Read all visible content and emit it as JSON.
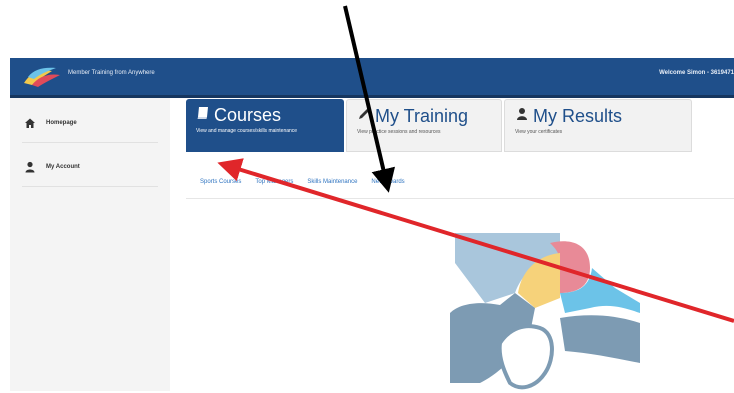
{
  "header": {
    "title": "Member Training from Anywhere",
    "welcome": "Welcome Simon - 3619471"
  },
  "sidebar": {
    "items": [
      {
        "label": "Homepage",
        "icon": "home-icon"
      },
      {
        "label": "My Account",
        "icon": "user-icon"
      }
    ]
  },
  "tabs": [
    {
      "title": "Courses",
      "description": "View and manage courses/skills maintenance",
      "icon": "book-icon"
    },
    {
      "title": "My Training",
      "description": "View practice sessions and resources",
      "icon": "pencil-icon"
    },
    {
      "title": "My Results",
      "description": "View your certificates",
      "icon": "user-icon"
    }
  ],
  "subnav": [
    "Sports Courses",
    "Top Managers",
    "Skills Maintenance",
    "New Awards"
  ],
  "colors": {
    "brand_blue": "#1f4f8a",
    "link_blue": "#2f74c0",
    "arrow_red": "#e0262a",
    "arrow_black": "#000000"
  }
}
